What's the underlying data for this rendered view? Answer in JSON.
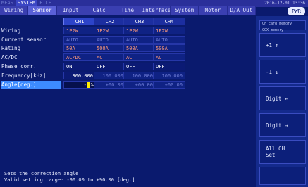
{
  "modes": [
    "MEAS",
    "SYSTEM",
    "FILE"
  ],
  "active_mode": 1,
  "datetime": "2016-12-01 13:36",
  "pwr_badge": "PWR",
  "tabs": [
    "Wiring",
    "Sensor",
    "Input",
    "Calc",
    "Time",
    "Interface",
    "System",
    "Motor",
    "D/A Out"
  ],
  "channels": [
    "CH1",
    "CH2",
    "CH3",
    "CH4"
  ],
  "rows": {
    "wiring": {
      "label": "Wiring",
      "values": [
        "1P2W",
        "1P2W",
        "1P2W",
        "1P2W"
      ]
    },
    "current_sensor": {
      "label": "Current sensor",
      "values": [
        "AUTO",
        "AUTO",
        "AUTO",
        "AUTO"
      ]
    },
    "rating": {
      "label": "Rating",
      "values": [
        "50A",
        "500A",
        "500A",
        "500A"
      ]
    },
    "acdc": {
      "label": "AC/DC",
      "values": [
        "AC/DC",
        "AC",
        "AC",
        "AC"
      ]
    },
    "phase": {
      "label": "Phase corr.",
      "values": [
        "ON",
        "OFF",
        "OFF",
        "OFF"
      ]
    },
    "frequency": {
      "label": "Frequency[kHz]",
      "values": [
        "300.000",
        "100.000",
        "100.000",
        "100.000"
      ]
    },
    "angle": {
      "label": "Angle[deg.]",
      "entry_sign": "-",
      "entry_tail": "%",
      "values": [
        "+00.00",
        "+00.00",
        "+00.00"
      ]
    }
  },
  "help": {
    "line1": "Sets the correction angle.",
    "line2": "Valid setting range: -90.00 to +90.00 [deg.]"
  },
  "side": {
    "top": "CF card memory\nCOX  memory",
    "buttons": [
      "+1 ↑",
      "-1 ↓",
      "Digit ←",
      "Digit →",
      "All CH\nSet"
    ]
  }
}
